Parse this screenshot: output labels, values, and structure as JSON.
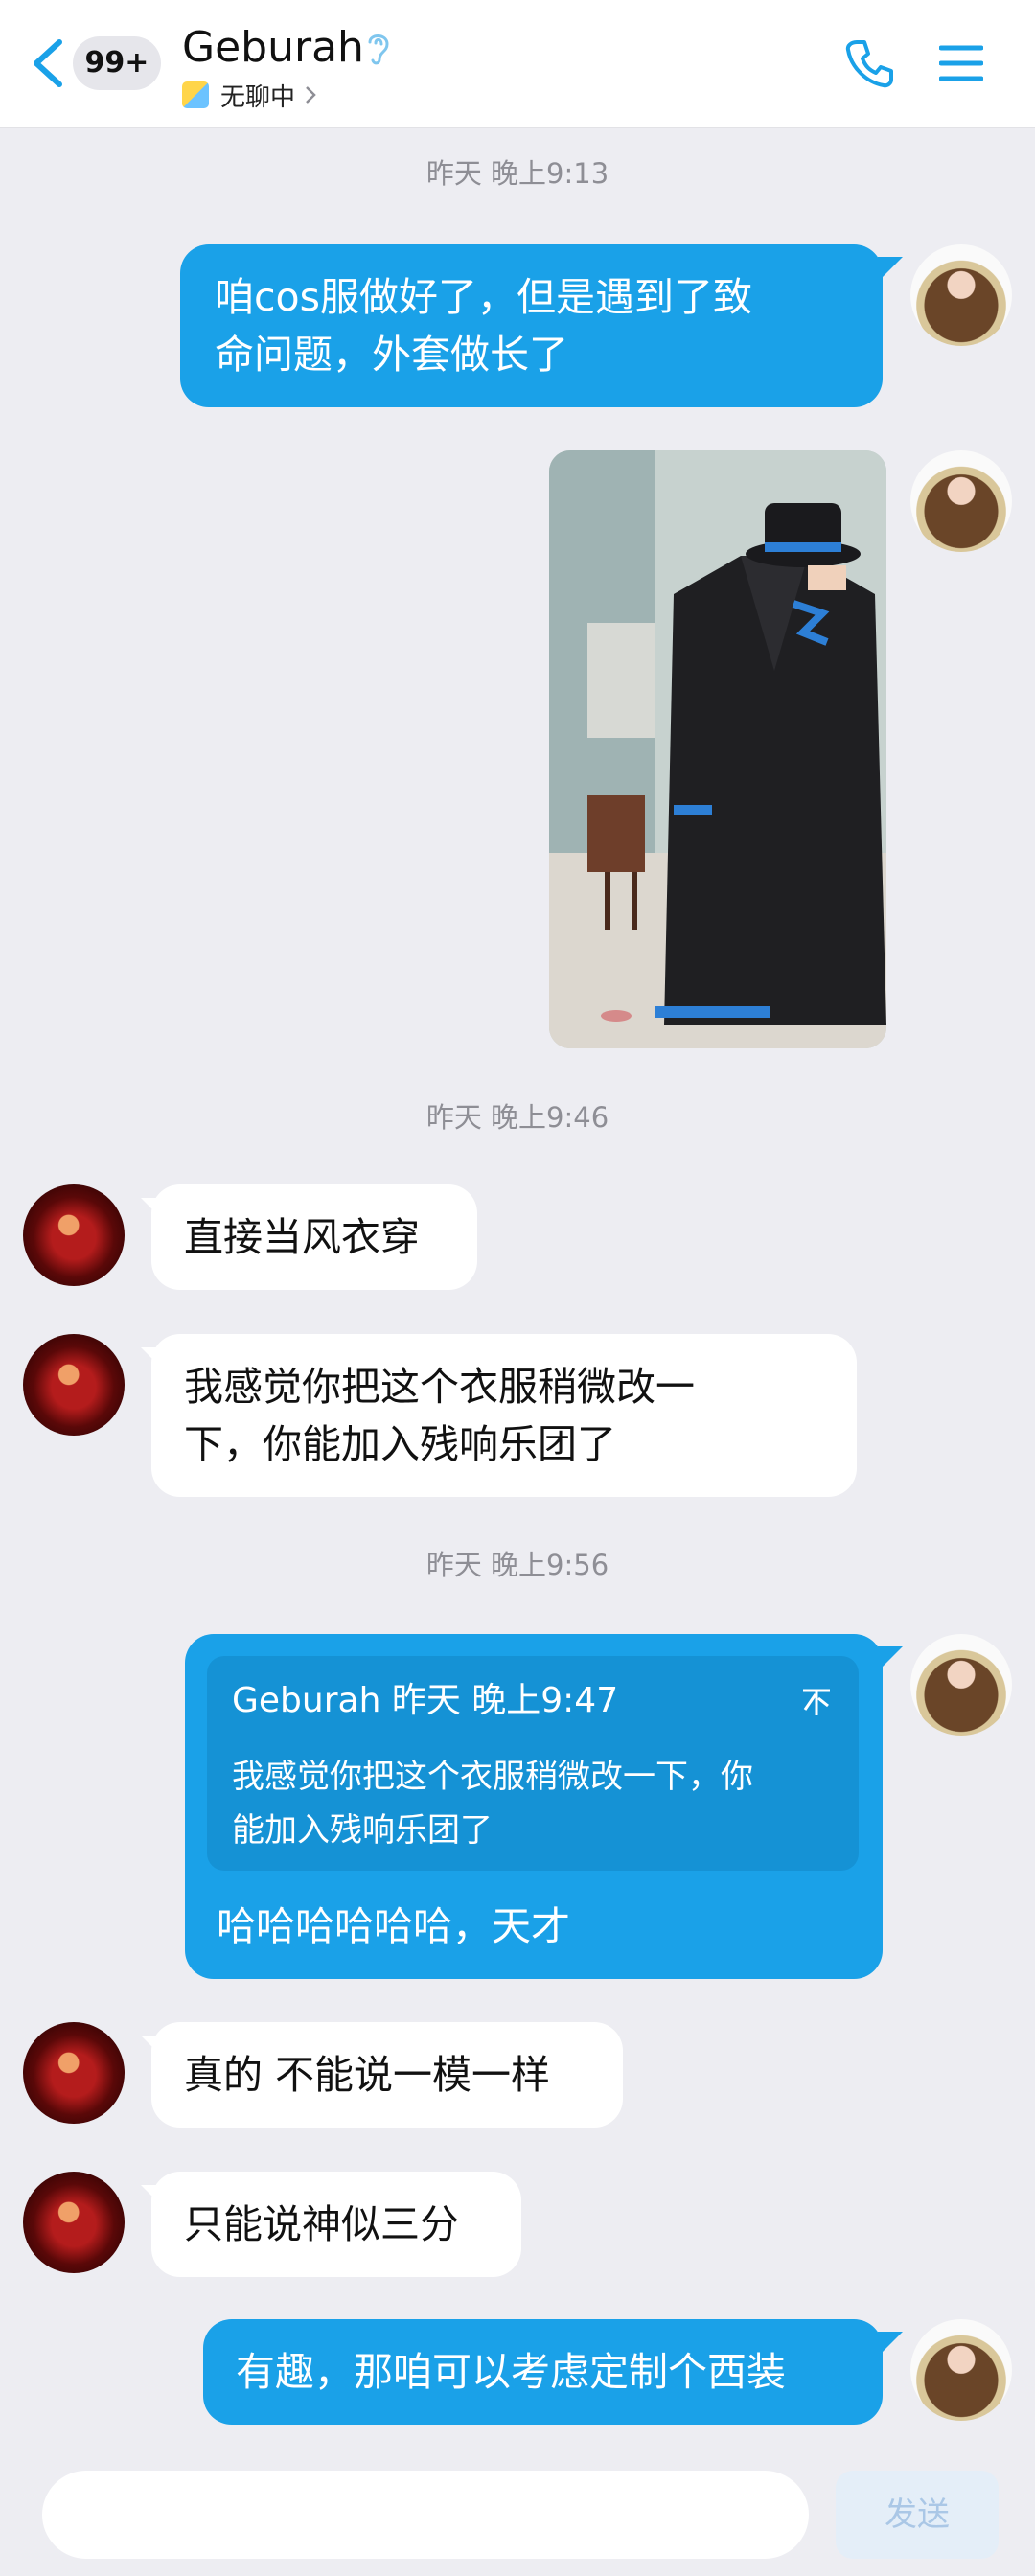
{
  "header": {
    "unread_badge": "99+",
    "contact_name": "Geburah",
    "status_text": "无聊中"
  },
  "messages": {
    "ts1": "昨天 晚上9:13",
    "m1_line1": "咱cos服做好了，但是遇到了致",
    "m1_line2": "命问题，外套做长了",
    "ts2": "昨天 晚上9:46",
    "m3": "直接当风衣穿",
    "m4_line1": "我感觉你把这个衣服稍微改一",
    "m4_line2": "下，你能加入残响乐团了",
    "ts3": "昨天 晚上9:56",
    "quote_header": "Geburah 昨天 晚上9:47",
    "quote_line1": "我感觉你把这个衣服稍微改一下，你",
    "quote_line2": "能加入残响乐团了",
    "m5_reply": "哈哈哈哈哈哈，天才",
    "m6": "真的 不能说一模一样",
    "m7": "只能说神似三分",
    "m8": "有趣，那咱可以考虑定制个西装"
  },
  "input": {
    "send_label": "发送"
  },
  "colors": {
    "accent": "#1aa1e8",
    "background": "#ededf2"
  }
}
